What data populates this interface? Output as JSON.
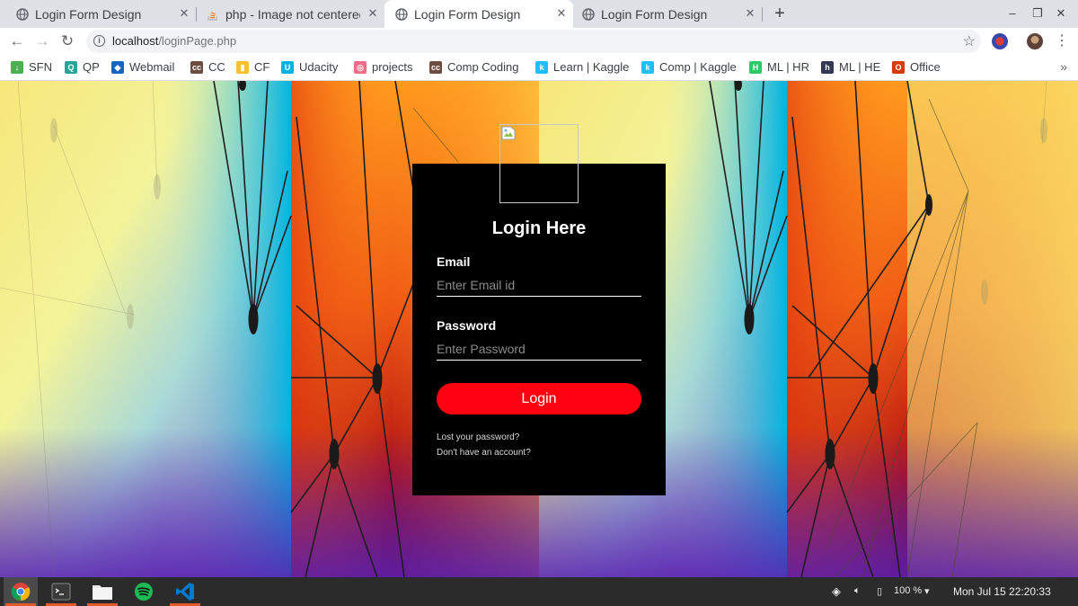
{
  "browser": {
    "tabs": [
      {
        "title": "Login Form Design",
        "favicon": "globe-icon",
        "active": false
      },
      {
        "title": "php - Image not centered",
        "favicon": "stackoverflow-icon",
        "active": false
      },
      {
        "title": "Login Form Design",
        "favicon": "globe-icon",
        "active": true
      },
      {
        "title": "Login Form Design",
        "favicon": "globe-icon",
        "active": false
      }
    ],
    "url_host": "localhost",
    "url_path": "/loginPage.php",
    "bookmarks": [
      {
        "label": "SFN",
        "icon": "sfn-icon",
        "color": "#4caf50"
      },
      {
        "label": "QP",
        "icon": "qp-icon",
        "color": "#26a69a"
      },
      {
        "label": "Webmail",
        "icon": "webmail-icon",
        "color": "#1565c0"
      },
      {
        "label": "CC",
        "icon": "cc-icon",
        "color": "#6d4c41"
      },
      {
        "label": "CF",
        "icon": "cf-icon",
        "color": "#fbc02d"
      },
      {
        "label": "Udacity",
        "icon": "udacity-icon",
        "color": "#02b3e4"
      },
      {
        "label": "projects",
        "icon": "projects-icon",
        "color": "#ec6b86"
      },
      {
        "label": "Comp Coding",
        "icon": "cc-icon",
        "color": "#6d4c41"
      },
      {
        "label": "Learn | Kaggle",
        "icon": "kaggle-icon",
        "color": "#20beff"
      },
      {
        "label": "Comp | Kaggle",
        "icon": "kaggle-icon",
        "color": "#20beff"
      },
      {
        "label": "ML | HR",
        "icon": "hackerrank-icon",
        "color": "#2ec866"
      },
      {
        "label": "ML | HE",
        "icon": "hackerearth-icon",
        "color": "#323754"
      },
      {
        "label": "Office",
        "icon": "office-icon",
        "color": "#d83b01"
      }
    ]
  },
  "login": {
    "title": "Login Here",
    "email_label": "Email",
    "email_placeholder": "Enter Email id",
    "password_label": "Password",
    "password_placeholder": "Enter Password",
    "button_label": "Login",
    "lost_password": "Lost your password?",
    "no_account": "Don't have an account?"
  },
  "colors": {
    "login_button": "#ff0010",
    "login_box": "#000000"
  },
  "taskbar": {
    "apps": [
      "chrome-icon",
      "terminal-icon",
      "files-icon",
      "spotify-icon",
      "vscode-icon"
    ],
    "battery": "100 %",
    "clock": "Mon Jul 15  22:20:33"
  }
}
